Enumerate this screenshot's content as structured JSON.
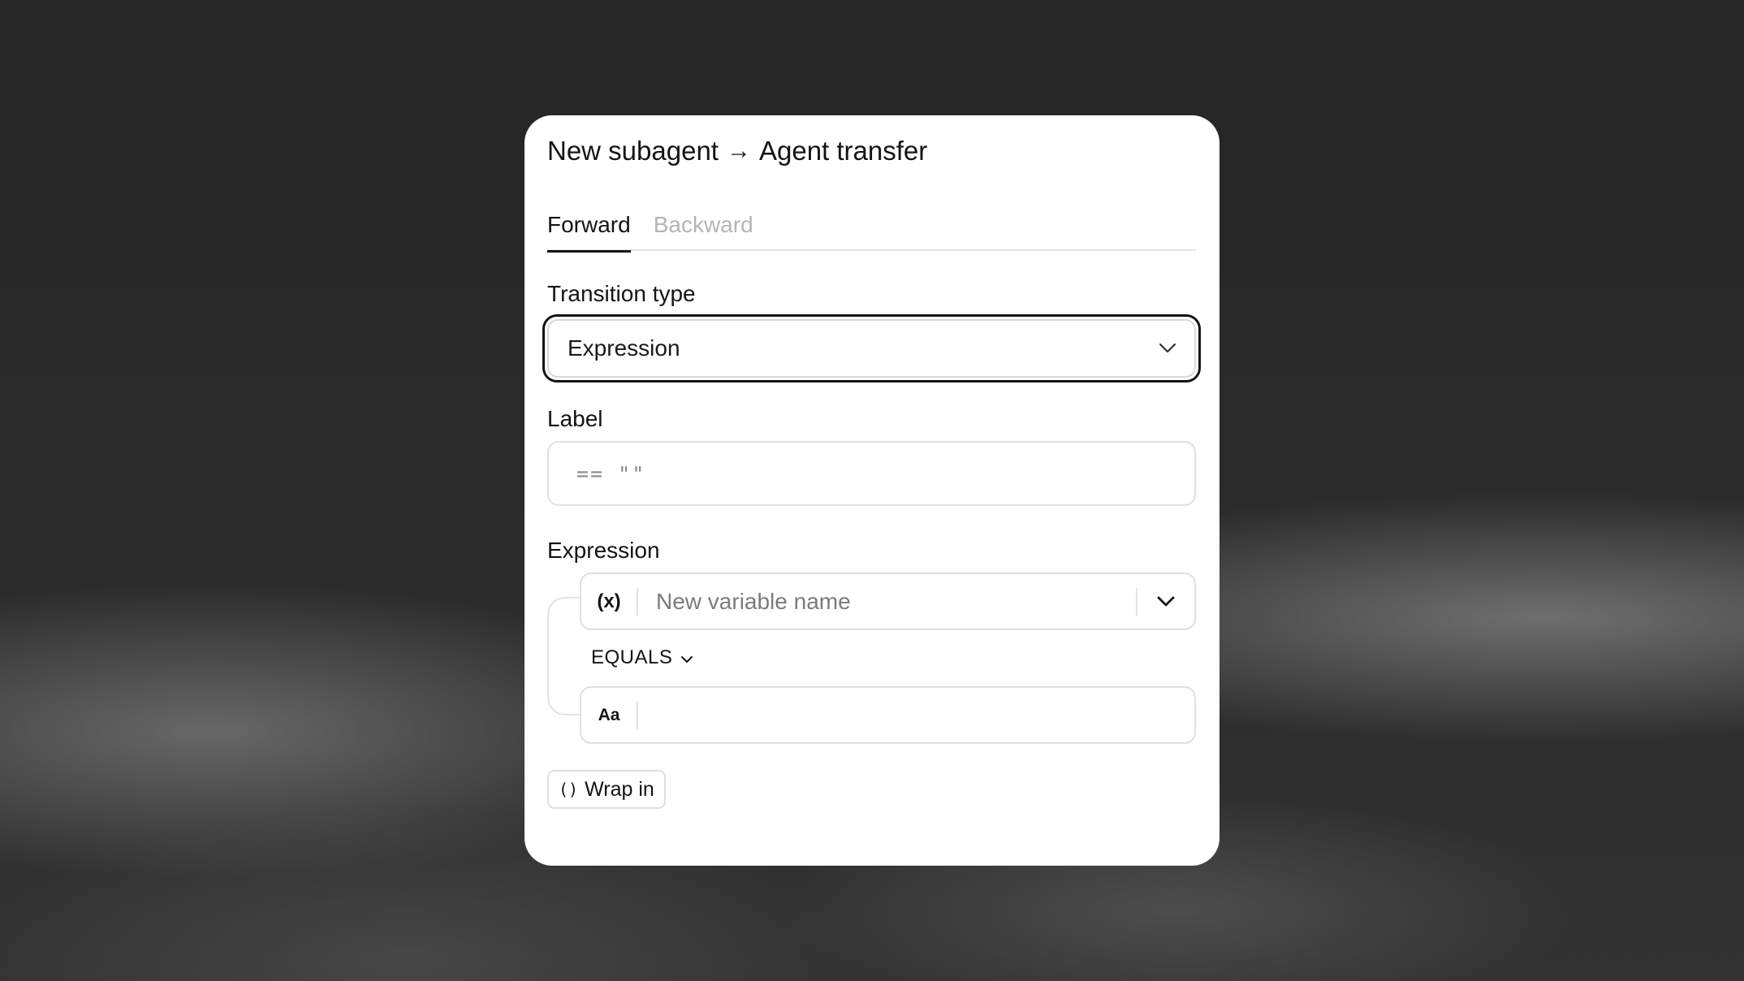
{
  "dialog": {
    "title_from": "New subagent",
    "title_arrow": "→",
    "title_to": "Agent transfer"
  },
  "tabs": [
    {
      "label": "Forward",
      "active": true
    },
    {
      "label": "Backward",
      "active": false
    }
  ],
  "transition_type": {
    "label": "Transition type",
    "selected": "Expression"
  },
  "label_field": {
    "label": "Label",
    "placeholder": "== \"\""
  },
  "expression": {
    "label": "Expression",
    "variable_icon": "variable-x-icon",
    "variable_glyph": "(x)",
    "variable_placeholder": "New variable name",
    "operator": "EQUALS",
    "value_icon_glyph": "Aa",
    "value": ""
  },
  "wrap_button": {
    "glyph": "()",
    "label": "Wrap in"
  }
}
